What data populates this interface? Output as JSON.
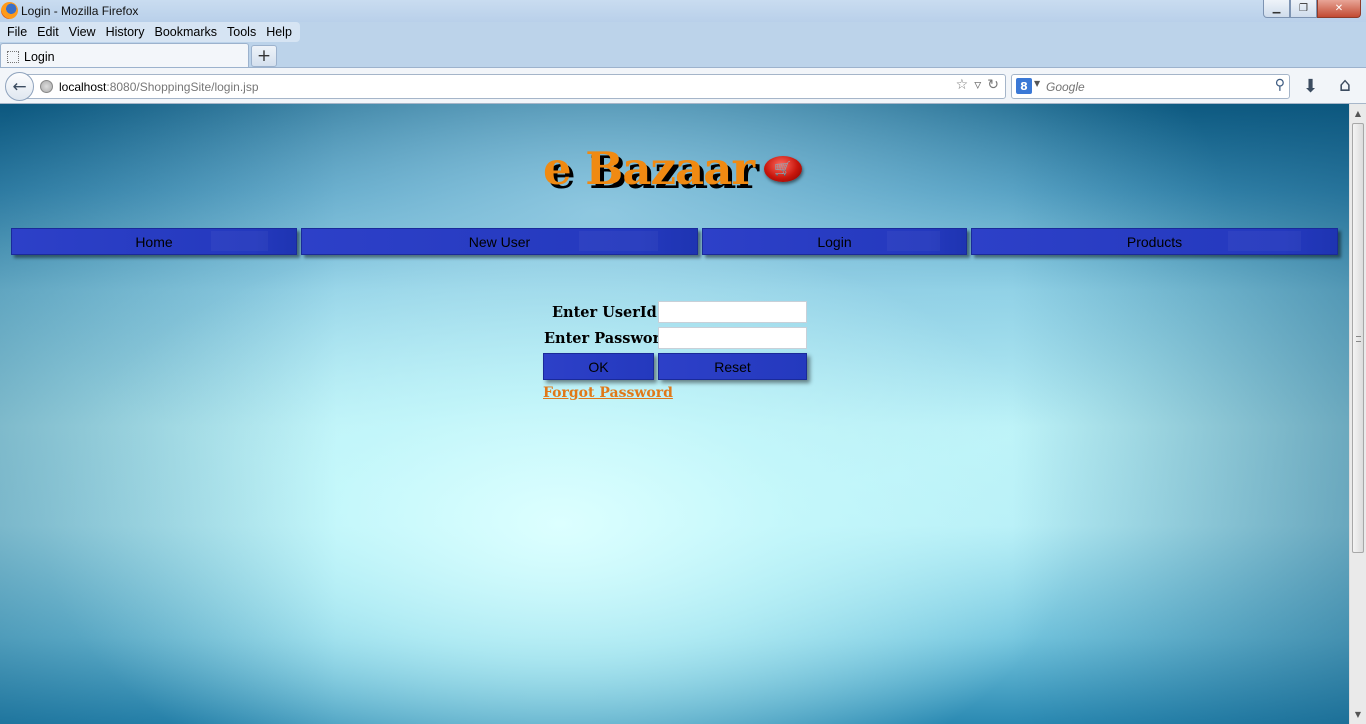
{
  "window": {
    "title": "Login - Mozilla Firefox",
    "controls": {
      "minimize": "▁",
      "restore": "❐",
      "close": "✕"
    }
  },
  "menubar": {
    "items": [
      "File",
      "Edit",
      "View",
      "History",
      "Bookmarks",
      "Tools",
      "Help"
    ]
  },
  "tabs": [
    {
      "label": "Login"
    }
  ],
  "newtab": {
    "label": "+"
  },
  "navbar": {
    "back_label": "←",
    "url_host": "localhost",
    "url_rest": ":8080/ShoppingSite/login.jsp",
    "search_placeholder": "Google",
    "search_engine_label": "8",
    "icons": {
      "bookmark": "☆",
      "dropdown": "▿",
      "reload": "↻",
      "search": "⚲",
      "download": "⬇",
      "home": "⌂"
    }
  },
  "site": {
    "title": "e Bazaar",
    "cart_glyph": "🛒",
    "colors": {
      "title": "#f08a12",
      "nav": "#2439be",
      "link": "#e07818"
    }
  },
  "nav": {
    "items": [
      {
        "label": "Home"
      },
      {
        "label": "New User"
      },
      {
        "label": "Login"
      },
      {
        "label": "Products"
      }
    ]
  },
  "login": {
    "userid_label": "Enter UserId:",
    "userid_value": "",
    "password_label": "Enter Password:",
    "password_value": "",
    "ok_label": "OK",
    "reset_label": "Reset",
    "forgot_label": "Forgot Password"
  },
  "scrollbar": {
    "up": "▲",
    "down": "▼"
  }
}
